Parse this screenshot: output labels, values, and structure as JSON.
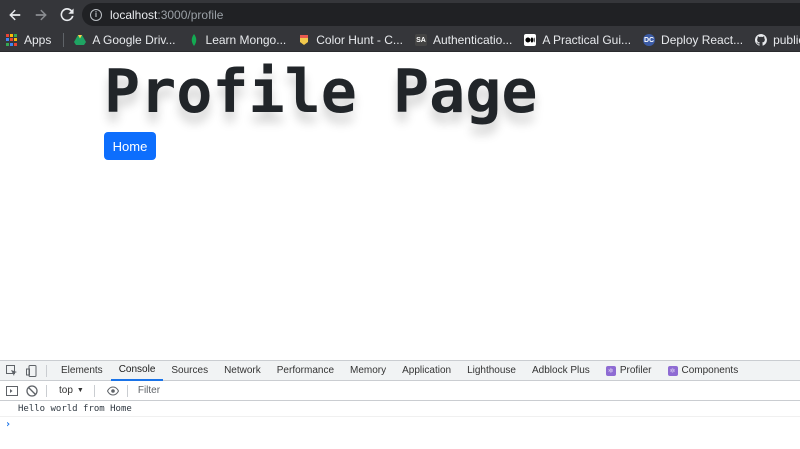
{
  "browser": {
    "url_host": "localhost",
    "url_path": ":3000/profile"
  },
  "bookmarks": [
    {
      "label": "Apps",
      "icon": "apps-grid-icon"
    },
    {
      "label": "A Google Driv...",
      "icon": "google-drive-icon",
      "color": "#1fa463"
    },
    {
      "label": "Learn Mongo...",
      "icon": "mongodb-leaf-icon",
      "color": "#13aa52"
    },
    {
      "label": "Color Hunt - C...",
      "icon": "color-hunt-icon",
      "color": "#f2c94c"
    },
    {
      "label": "Authenticatio...",
      "icon": "sa-logo-icon",
      "color": "#444444"
    },
    {
      "label": "A Practical Gui...",
      "icon": "medium-icon",
      "color": "#000000"
    },
    {
      "label": "Deploy React...",
      "icon": "dc-logo-icon",
      "color": "#3b5ba5"
    },
    {
      "label": "public-a",
      "icon": "github-icon",
      "color": "#e8eaed"
    }
  ],
  "page": {
    "title": "Profile Page",
    "home_button": "Home"
  },
  "devtools": {
    "tabs": [
      "Elements",
      "Console",
      "Sources",
      "Network",
      "Performance",
      "Memory",
      "Application",
      "Lighthouse",
      "Adblock Plus",
      "Profiler",
      "Components"
    ],
    "active_tab": "Console",
    "context": "top",
    "filter_placeholder": "Filter",
    "console_messages": [
      "Hello world from Home"
    ],
    "prompt": "›"
  },
  "colors": {
    "chrome_bg": "#35363a",
    "omnibox_bg": "#202124",
    "primary_button": "#0d6efd",
    "devtools_accent": "#1a73e8"
  }
}
